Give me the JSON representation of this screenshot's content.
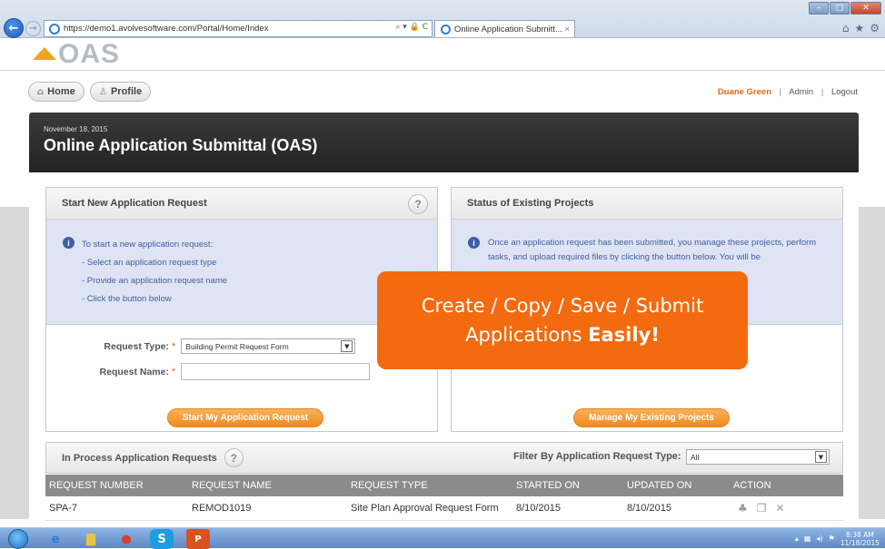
{
  "browser": {
    "url": "https://demo1.avolvesoftware.com/Portal/Home/Index",
    "tab_title": "Online Application Submitt...",
    "tab_close": "×",
    "addr_controls": "⌕ ▾ 🔒 C"
  },
  "header": {
    "logo_text": "OAS",
    "nav": {
      "home": "Home",
      "profile": "Profile"
    },
    "user": {
      "name": "Duane Green",
      "admin": "Admin",
      "logout": "Logout",
      "sep": "|"
    }
  },
  "banner": {
    "date": "November 18, 2015",
    "title": "Online Application Submittal (OAS)"
  },
  "new_request": {
    "title": "Start New Application Request",
    "help": "?",
    "info": [
      "To start a new application request:",
      "- Select an application request type",
      "- Provide an application request name",
      "- Click the button below"
    ],
    "type_label": "Request Type:",
    "type_value": "Building Permit Request Form",
    "name_label": "Request Name:",
    "required_mark": "*",
    "button": "Start My Application Request"
  },
  "existing": {
    "title": "Status of Existing Projects",
    "info": "Once an application request has been submitted, you manage these projects, perform tasks, and upload required files by clicking the button below. You will be",
    "button": "Manage My Existing Projects"
  },
  "in_process": {
    "title": "In Process Application Requests",
    "help": "?",
    "filter_label": "Filter By Application Request Type:",
    "filter_value": "All",
    "columns": [
      "REQUEST NUMBER",
      "REQUEST NAME",
      "REQUEST TYPE",
      "STARTED ON",
      "UPDATED ON",
      "ACTION"
    ],
    "rows": [
      {
        "number": "SPA-7",
        "name": "REMOD1019",
        "type": "Site Plan Approval Request Form",
        "started": "8/10/2015",
        "updated": "8/10/2015"
      }
    ]
  },
  "callout": {
    "line1": "Create / Copy / Save / Submit",
    "line2_pre": "Applications ",
    "line2_bold": "Easily!"
  },
  "taskbar": {
    "time": "8:38 AM",
    "date": "11/18/2015"
  },
  "colors": {
    "accent": "#f08a20",
    "callout": "#f46a0f",
    "banner": "#2b2b2b",
    "info_bg": "#dfe4f4"
  }
}
